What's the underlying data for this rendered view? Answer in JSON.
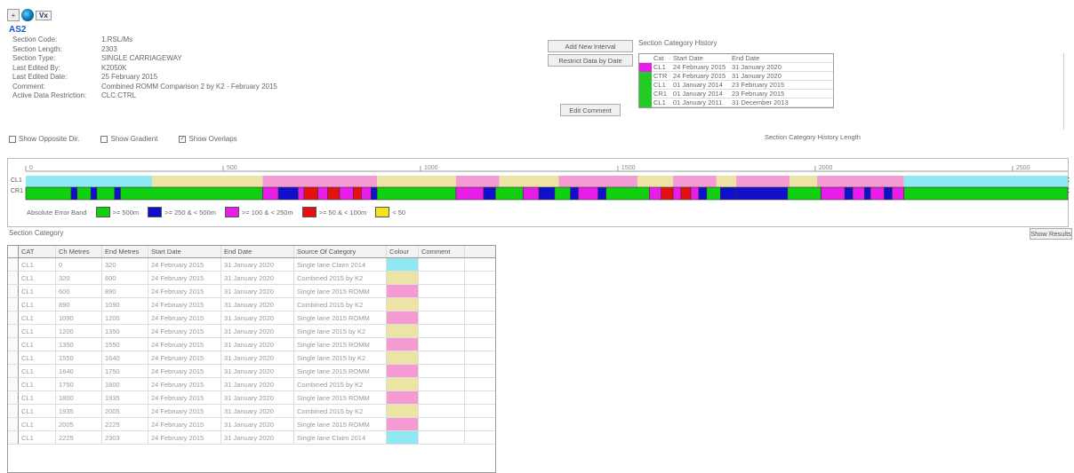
{
  "toolbar": {
    "first_icon": "plus-icon",
    "second_icon": "globe-icon",
    "mode_label": "Vx"
  },
  "section_title": "AS2",
  "details": [
    {
      "label": "Section Code:",
      "value": "1.RSL/Ms"
    },
    {
      "label": "Section Length:",
      "value": "2303"
    },
    {
      "label": "Section Type:",
      "value": "SINGLE CARRIAGEWAY"
    },
    {
      "label": "Last Edited By:",
      "value": "K2050K"
    },
    {
      "label": "Last Edited Date:",
      "value": "25 February 2015"
    },
    {
      "label": "Comment:",
      "value": "Combined ROMM Comparison 2 by K2 - February 2015"
    },
    {
      "label": "Active Data Restriction:",
      "value": "CLC.CTRL"
    }
  ],
  "checkboxes": [
    {
      "label": "Show Opposite Dir.",
      "checked": false
    },
    {
      "label": "Show Gradient",
      "checked": false
    },
    {
      "label": "Show Overlaps",
      "checked": true
    }
  ],
  "buttons": {
    "top": "Add New Interval",
    "second": "Restrict Data by Date",
    "third": "Edit Comment"
  },
  "category_history": {
    "label": "Section Category History",
    "columns": [
      "Cat",
      "Start Date",
      "End Date"
    ],
    "rows": [
      {
        "color": "#e81de8",
        "cat": "CL1",
        "start": "24 February 2015",
        "end": "31 January 2020"
      },
      {
        "color": "#22cc22",
        "cat": "CTR",
        "start": "24 February 2015",
        "end": "31 January 2020"
      },
      {
        "color": "#22cc22",
        "cat": "CL1",
        "start": "01 January 2014",
        "end": "23 February 2015"
      },
      {
        "color": "#22cc22",
        "cat": "CR1",
        "start": "01 January 2014",
        "end": "23 February 2015"
      },
      {
        "color": "#22cc22",
        "cat": "CL1",
        "start": "01 January 2011",
        "end": "31 December 2013"
      }
    ],
    "subcaption": "Section Category History Length"
  },
  "chart_data": {
    "type": "table",
    "axis_ticks": [
      0,
      500,
      1000,
      1500,
      2000,
      2500
    ],
    "tick_labels": [
      "0",
      "500",
      "1000",
      "1500",
      "2000",
      "2500"
    ],
    "section_length_m": 2303,
    "row_labels": [
      "CL1",
      "CR1"
    ],
    "right_labels": [
      "CL1",
      "CR1"
    ],
    "overlap_segments": [
      {
        "start": 0,
        "end": 320,
        "color": "#8fe8f2"
      },
      {
        "start": 320,
        "end": 600,
        "color": "#ece3a6"
      },
      {
        "start": 600,
        "end": 890,
        "color": "#f59bd4"
      },
      {
        "start": 890,
        "end": 1090,
        "color": "#ece3a6"
      },
      {
        "start": 1090,
        "end": 1200,
        "color": "#f59bd4"
      },
      {
        "start": 1200,
        "end": 1350,
        "color": "#ece3a6"
      },
      {
        "start": 1350,
        "end": 1550,
        "color": "#f59bd4"
      },
      {
        "start": 1550,
        "end": 1640,
        "color": "#ece3a6"
      },
      {
        "start": 1640,
        "end": 1750,
        "color": "#f59bd4"
      },
      {
        "start": 1750,
        "end": 1800,
        "color": "#ece3a6"
      },
      {
        "start": 1800,
        "end": 1935,
        "color": "#f59bd4"
      },
      {
        "start": 1935,
        "end": 2005,
        "color": "#ece3a6"
      },
      {
        "start": 2005,
        "end": 2225,
        "color": "#f59bd4"
      },
      {
        "start": 2225,
        "end": 2640,
        "color": "#8fe8f2"
      }
    ],
    "condition_segments": [
      {
        "start": 0,
        "end": 115,
        "color": "#10d010"
      },
      {
        "start": 115,
        "end": 130,
        "color": "#1010cc"
      },
      {
        "start": 130,
        "end": 165,
        "color": "#10d010"
      },
      {
        "start": 165,
        "end": 180,
        "color": "#1010cc"
      },
      {
        "start": 180,
        "end": 225,
        "color": "#10d010"
      },
      {
        "start": 225,
        "end": 240,
        "color": "#1010cc"
      },
      {
        "start": 240,
        "end": 600,
        "color": "#10d010"
      },
      {
        "start": 600,
        "end": 640,
        "color": "#e81de8"
      },
      {
        "start": 640,
        "end": 690,
        "color": "#1010cc"
      },
      {
        "start": 690,
        "end": 705,
        "color": "#e81de8"
      },
      {
        "start": 705,
        "end": 740,
        "color": "#e51010"
      },
      {
        "start": 740,
        "end": 765,
        "color": "#e81de8"
      },
      {
        "start": 765,
        "end": 795,
        "color": "#e51010"
      },
      {
        "start": 795,
        "end": 830,
        "color": "#e81de8"
      },
      {
        "start": 830,
        "end": 850,
        "color": "#e51010"
      },
      {
        "start": 850,
        "end": 875,
        "color": "#e81de8"
      },
      {
        "start": 875,
        "end": 890,
        "color": "#1010cc"
      },
      {
        "start": 890,
        "end": 1090,
        "color": "#10d010"
      },
      {
        "start": 1090,
        "end": 1160,
        "color": "#e81de8"
      },
      {
        "start": 1160,
        "end": 1190,
        "color": "#1010cc"
      },
      {
        "start": 1190,
        "end": 1260,
        "color": "#10d010"
      },
      {
        "start": 1260,
        "end": 1300,
        "color": "#e81de8"
      },
      {
        "start": 1300,
        "end": 1340,
        "color": "#1010cc"
      },
      {
        "start": 1340,
        "end": 1380,
        "color": "#10d010"
      },
      {
        "start": 1380,
        "end": 1400,
        "color": "#1010cc"
      },
      {
        "start": 1400,
        "end": 1450,
        "color": "#e81de8"
      },
      {
        "start": 1450,
        "end": 1470,
        "color": "#1010cc"
      },
      {
        "start": 1470,
        "end": 1580,
        "color": "#10d010"
      },
      {
        "start": 1580,
        "end": 1610,
        "color": "#e81de8"
      },
      {
        "start": 1610,
        "end": 1640,
        "color": "#e51010"
      },
      {
        "start": 1640,
        "end": 1660,
        "color": "#e81de8"
      },
      {
        "start": 1660,
        "end": 1685,
        "color": "#e51010"
      },
      {
        "start": 1685,
        "end": 1705,
        "color": "#e81de8"
      },
      {
        "start": 1705,
        "end": 1725,
        "color": "#1010cc"
      },
      {
        "start": 1725,
        "end": 1760,
        "color": "#10d010"
      },
      {
        "start": 1760,
        "end": 1800,
        "color": "#1010cc"
      },
      {
        "start": 1800,
        "end": 1930,
        "color": "#1010cc"
      },
      {
        "start": 1930,
        "end": 2015,
        "color": "#10d010"
      },
      {
        "start": 2015,
        "end": 2075,
        "color": "#e81de8"
      },
      {
        "start": 2075,
        "end": 2095,
        "color": "#1010cc"
      },
      {
        "start": 2095,
        "end": 2125,
        "color": "#e81de8"
      },
      {
        "start": 2125,
        "end": 2140,
        "color": "#1010cc"
      },
      {
        "start": 2140,
        "end": 2175,
        "color": "#e81de8"
      },
      {
        "start": 2175,
        "end": 2195,
        "color": "#1010cc"
      },
      {
        "start": 2195,
        "end": 2225,
        "color": "#e81de8"
      },
      {
        "start": 2225,
        "end": 2640,
        "color": "#10d010"
      }
    ],
    "legend_title": "Absolute Error Band",
    "legend": [
      {
        "label": ">= 500m",
        "color": "#10d010"
      },
      {
        "label": ">= 250 & < 500m",
        "color": "#1010cc"
      },
      {
        "label": ">= 100 & < 250m",
        "color": "#e81de8"
      },
      {
        "label": ">= 50 & < 100m",
        "color": "#e51010"
      },
      {
        "label": "< 50",
        "color": "#f4e21a"
      }
    ]
  },
  "section_list": {
    "label": "Section Category",
    "filter_button": "Show Results",
    "columns": [
      "CAT",
      "Ch Metres",
      "End Metres",
      "Start Date",
      "End Date",
      "Source Of Category",
      "Colour",
      "Comment"
    ],
    "rows": [
      {
        "cat": "CL1",
        "ch": "0",
        "end": "320",
        "start": "24 February 2015",
        "enddate": "31 January 2020",
        "src": "Single lane Claim 2014",
        "color": "#8fe8f2"
      },
      {
        "cat": "CL1",
        "ch": "320",
        "end": "600",
        "start": "24 February 2015",
        "enddate": "31 January 2020",
        "src": "Combined 2015 by K2",
        "color": "#ece3a6"
      },
      {
        "cat": "CL1",
        "ch": "600",
        "end": "890",
        "start": "24 February 2015",
        "enddate": "31 January 2020",
        "src": "Single lane 2015 ROMM",
        "color": "#f59bd4"
      },
      {
        "cat": "CL1",
        "ch": "890",
        "end": "1090",
        "start": "24 February 2015",
        "enddate": "31 January 2020",
        "src": "Combined 2015 by K2",
        "color": "#ece3a6"
      },
      {
        "cat": "CL1",
        "ch": "1090",
        "end": "1200",
        "start": "24 February 2015",
        "enddate": "31 January 2020",
        "src": "Single lane 2015 ROMM",
        "color": "#f59bd4"
      },
      {
        "cat": "CL1",
        "ch": "1200",
        "end": "1350",
        "start": "24 February 2015",
        "enddate": "31 January 2020",
        "src": "Single lane 2015 by K2",
        "color": "#ece3a6"
      },
      {
        "cat": "CL1",
        "ch": "1350",
        "end": "1550",
        "start": "24 February 2015",
        "enddate": "31 January 2020",
        "src": "Single lane 2015 ROMM",
        "color": "#f59bd4"
      },
      {
        "cat": "CL1",
        "ch": "1550",
        "end": "1640",
        "start": "24 February 2015",
        "enddate": "31 January 2020",
        "src": "Single lane 2015 by K2",
        "color": "#ece3a6"
      },
      {
        "cat": "CL1",
        "ch": "1640",
        "end": "1750",
        "start": "24 February 2015",
        "enddate": "31 January 2020",
        "src": "Single lane 2015 ROMM",
        "color": "#f59bd4"
      },
      {
        "cat": "CL1",
        "ch": "1750",
        "end": "1800",
        "start": "24 February 2015",
        "enddate": "31 January 2020",
        "src": "Combined 2015 by K2",
        "color": "#ece3a6"
      },
      {
        "cat": "CL1",
        "ch": "1800",
        "end": "1935",
        "start": "24 February 2015",
        "enddate": "31 January 2020",
        "src": "Single lane 2015 ROMM",
        "color": "#f59bd4"
      },
      {
        "cat": "CL1",
        "ch": "1935",
        "end": "2005",
        "start": "24 February 2015",
        "enddate": "31 January 2020",
        "src": "Combined 2015 by K2",
        "color": "#ece3a6"
      },
      {
        "cat": "CL1",
        "ch": "2005",
        "end": "2225",
        "start": "24 February 2015",
        "enddate": "31 January 2020",
        "src": "Single lane 2015 ROMM",
        "color": "#f59bd4"
      },
      {
        "cat": "CL1",
        "ch": "2225",
        "end": "2303",
        "start": "24 February 2015",
        "enddate": "31 January 2020",
        "src": "Single lane Claim 2014",
        "color": "#8fe8f2"
      }
    ]
  }
}
